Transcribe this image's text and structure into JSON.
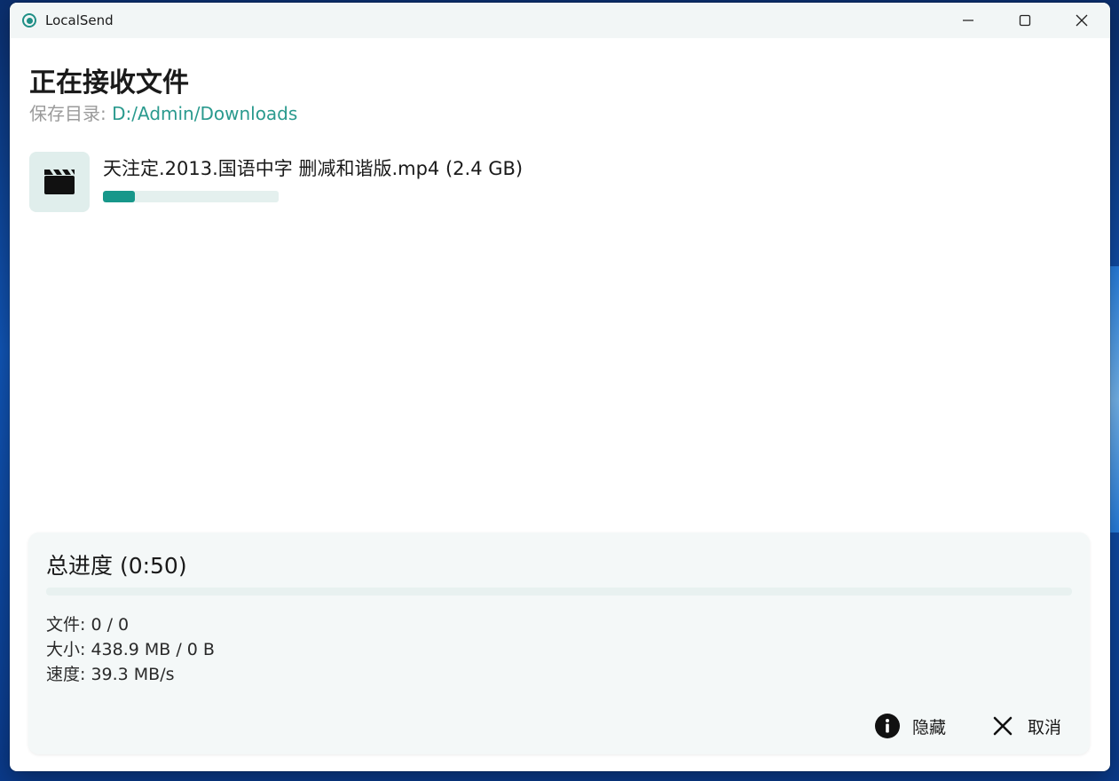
{
  "window": {
    "app_title": "LocalSend",
    "controls": {
      "minimize_icon": "minimize-icon",
      "maximize_icon": "maximize-icon",
      "close_icon": "close-icon"
    }
  },
  "header": {
    "title": "正在接收文件",
    "save_dir_label": "保存目录:",
    "save_dir_path": "D:/Admin/Downloads"
  },
  "files": [
    {
      "icon": "video-clapperboard-icon",
      "name": "天注定.2013.国语中字 删减和谐版.mp4 (2.4 GB)",
      "progress": 0.18
    }
  ],
  "total": {
    "title": "总进度 (0:50)",
    "progress": 0,
    "stats": {
      "files": "文件: 0 / 0",
      "size": "大小: 438.9 MB / 0 B",
      "speed": "速度: 39.3 MB/s"
    }
  },
  "actions": {
    "hide_label": "隐藏",
    "hide_icon": "info-icon",
    "cancel_label": "取消",
    "cancel_icon": "close-x-icon"
  },
  "colors": {
    "accent": "#17978A",
    "save_path": "#2A9A8E",
    "panel_bg": "#F4F8F8",
    "thumb_bg": "#E0EEEC"
  }
}
